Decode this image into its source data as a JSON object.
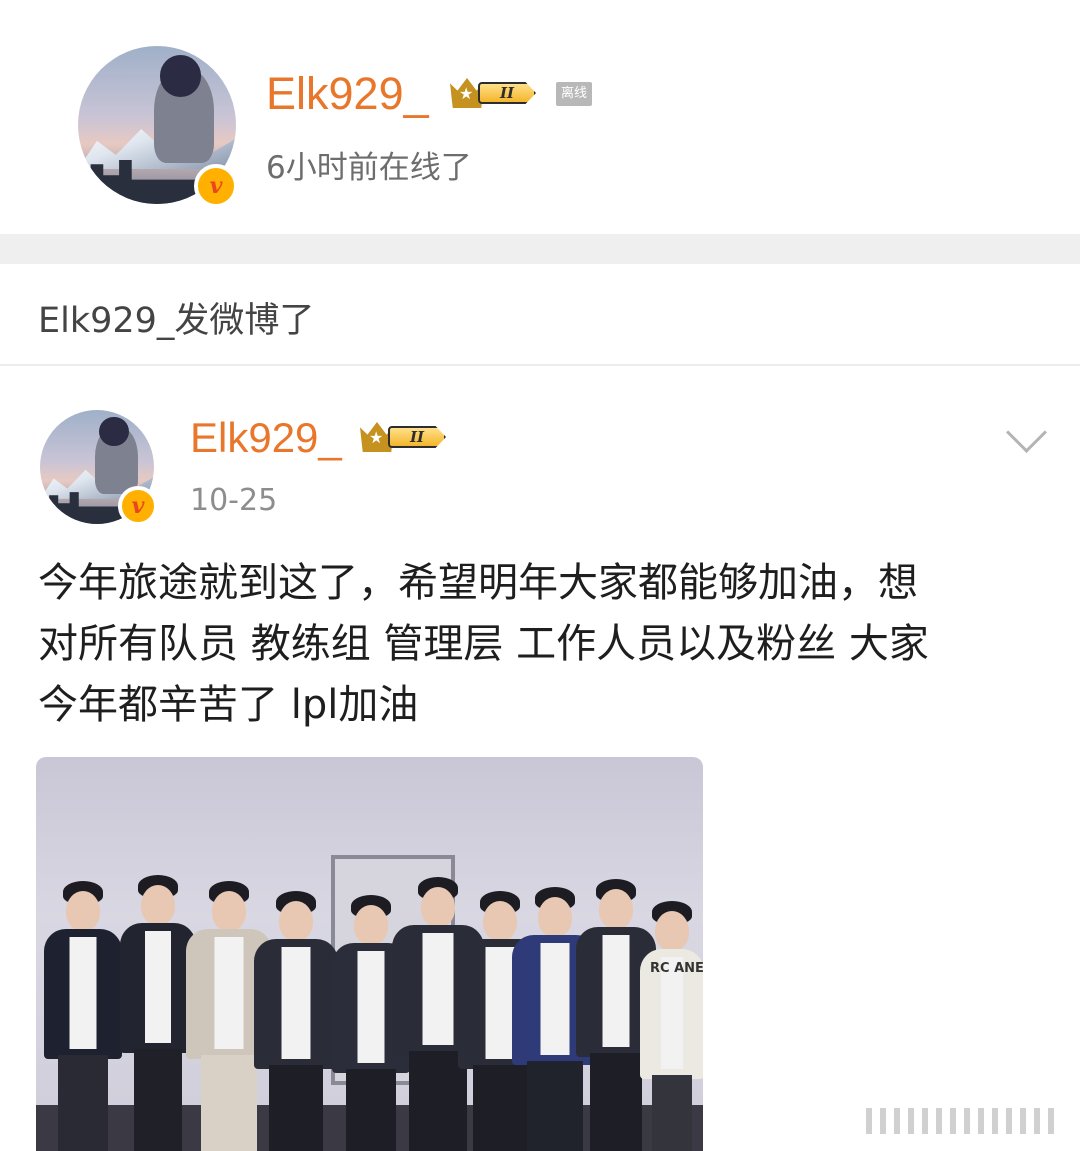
{
  "profile": {
    "username": "Elk929_",
    "vip_level": "II",
    "status_tag": "离线",
    "last_online": "6小时前在线了"
  },
  "section": {
    "title": "Elk929_发微博了"
  },
  "post": {
    "username": "Elk929_",
    "vip_level": "II",
    "date": "10-25",
    "text_lines": [
      "今年旅途就到这了，希望明年大家都能够加油，想",
      "对所有队员 教练组 管理层 工作人员以及粉丝 大家",
      "今年都辛苦了 lpl加油"
    ]
  },
  "photo": {
    "jacket_text": "RC ANE"
  },
  "colors": {
    "username": "#e9772b",
    "verified_badge": "#ffb000",
    "band": "#efefef"
  },
  "icons": {
    "verified": "verified-v-icon",
    "vip": "vip-crown-icon",
    "more": "chevron-down-icon"
  }
}
